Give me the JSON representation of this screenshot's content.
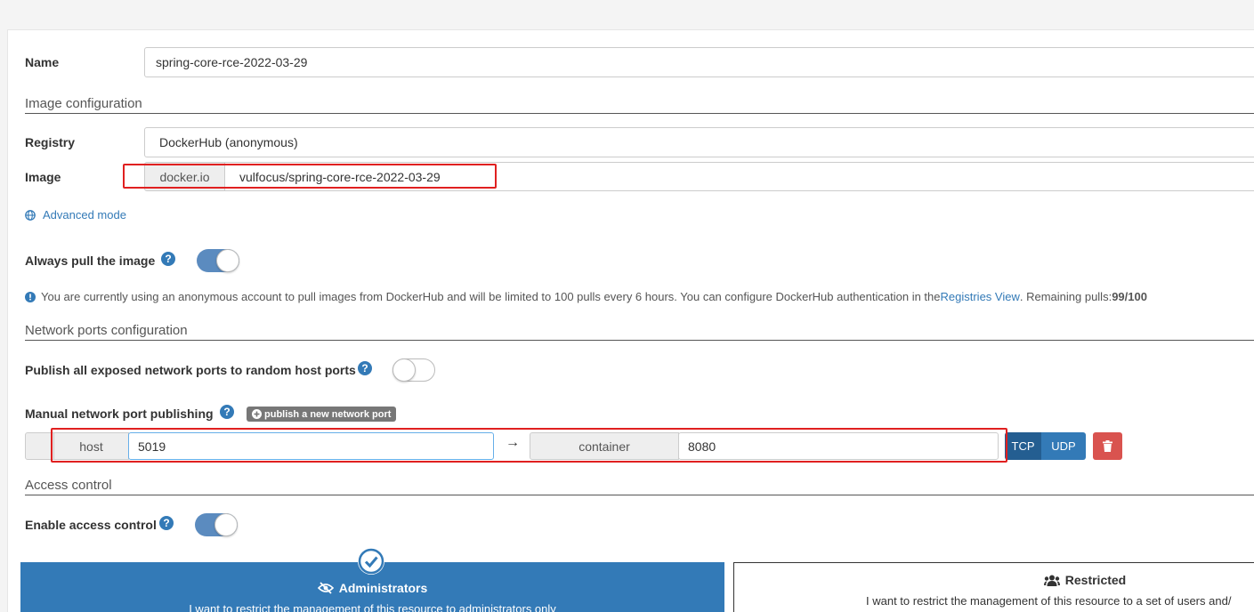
{
  "name": {
    "label": "Name",
    "value": "spring-core-rce-2022-03-29"
  },
  "image_config": {
    "section_title": "Image configuration",
    "registry_label": "Registry",
    "registry_value": "DockerHub (anonymous)",
    "image_label": "Image",
    "image_prefix": "docker.io",
    "image_value": "vulfocus/spring-core-rce-2022-03-29",
    "advanced_link": "Advanced mode",
    "always_pull_label": "Always pull the image",
    "always_pull_enabled": true,
    "notice": {
      "text": "You are currently using an anonymous account to pull images from DockerHub and will be limited to 100 pulls every 6 hours. You can configure DockerHub authentication in the ",
      "link": "Registries View",
      "suffix": ". Remaining pulls: ",
      "remaining": "99/100"
    }
  },
  "network": {
    "section_title": "Network ports configuration",
    "publish_all_label": "Publish all exposed network ports to random host ports",
    "publish_all_enabled": false,
    "manual_label": "Manual network port publishing",
    "add_port_button": "publish a new network port",
    "port_row": {
      "host_label": "host",
      "host_value": "5019",
      "arrow": "→",
      "container_label": "container",
      "container_value": "8080",
      "tcp": "TCP",
      "udp": "UDP"
    }
  },
  "access": {
    "section_title": "Access control",
    "enable_label": "Enable access control",
    "enabled": true,
    "admin_card": {
      "title": "Administrators",
      "desc": "I want to restrict the management of this resource to administrators only"
    },
    "restricted_card": {
      "title": "Restricted",
      "desc": "I want to restrict the management of this resource to a set of users and/"
    }
  },
  "colors": {
    "accent": "#337ab7",
    "danger": "#d9534f",
    "highlight": "#e02020"
  }
}
